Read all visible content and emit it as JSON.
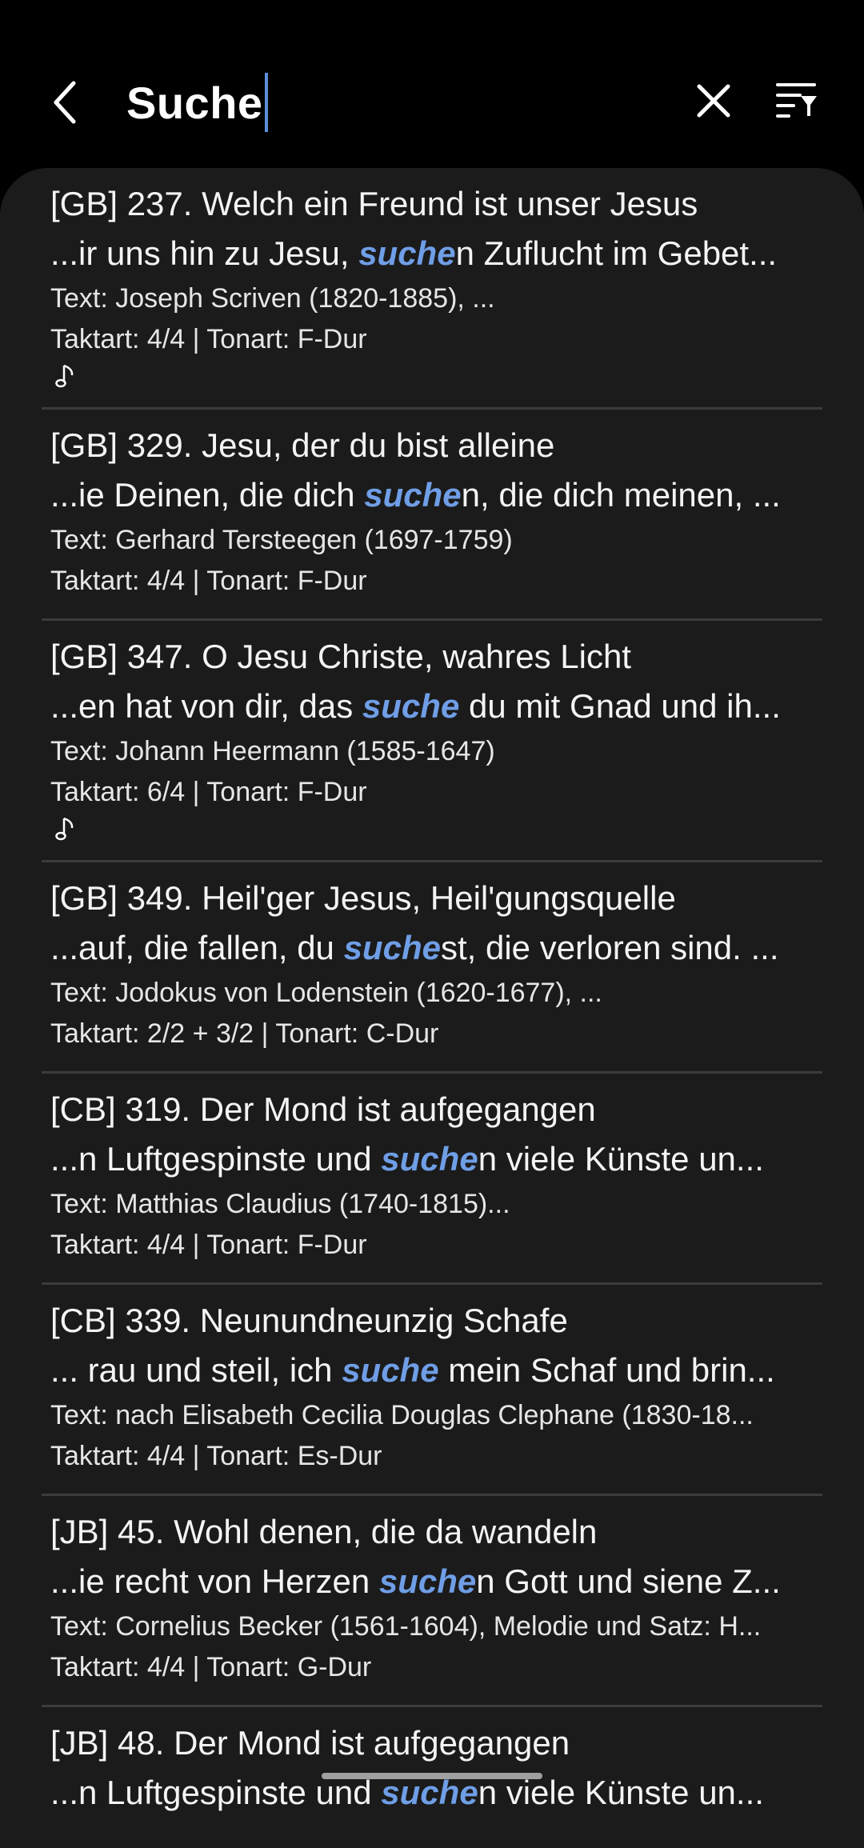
{
  "header": {
    "search_value": "Suche",
    "back_icon": "chevron-left-icon",
    "clear_icon": "close-icon",
    "filter_icon": "filter-list-icon"
  },
  "colors": {
    "highlight": "#6f9ee6",
    "background": "#000000",
    "panel": "#1b1b1b"
  },
  "results": [
    {
      "title": "[GB] 237. Welch ein Freund ist unser Jesus",
      "snippet_pre": "...ir uns hin zu Jesu, ",
      "snippet_match": "suche",
      "snippet_post": "n Zuflucht im Gebet...",
      "author": "Text: Joseph Scriven (1820-1885), ...",
      "meta": "Taktart: 4/4  |  Tonart: F-Dur",
      "has_audio": true
    },
    {
      "title": "[GB] 329. Jesu, der du bist alleine",
      "snippet_pre": "...ie Deinen, die dich ",
      "snippet_match": "suche",
      "snippet_post": "n, die dich meinen, ...",
      "author": "Text: Gerhard Tersteegen (1697-1759)",
      "meta": "Taktart: 4/4  |  Tonart: F-Dur",
      "has_audio": false
    },
    {
      "title": "[GB] 347. O Jesu Christe, wahres Licht",
      "snippet_pre": "...en hat von dir, das ",
      "snippet_match": "suche",
      "snippet_post": " du mit Gnad und ih...",
      "author": "Text: Johann Heermann (1585-1647)",
      "meta": "Taktart: 6/4  |  Tonart: F-Dur",
      "has_audio": true
    },
    {
      "title": "[GB] 349. Heil'ger Jesus, Heil'gungsquelle",
      "snippet_pre": "...auf, die fallen, du ",
      "snippet_match": "suche",
      "snippet_post": "st, die verloren sind. ...",
      "author": "Text: Jodokus von Lodenstein (1620-1677), ...",
      "meta": "Taktart: 2/2 + 3/2  |  Tonart: C-Dur",
      "has_audio": false
    },
    {
      "title": "[CB] 319. Der Mond ist aufgegangen",
      "snippet_pre": "...n Luftgespinste und ",
      "snippet_match": "suche",
      "snippet_post": "n viele Künste un...",
      "author": "Text: Matthias Claudius (1740-1815)...",
      "meta": "Taktart: 4/4  |  Tonart: F-Dur",
      "has_audio": false
    },
    {
      "title": "[CB] 339. Neunundneunzig Schafe",
      "snippet_pre": "... rau und steil, ich ",
      "snippet_match": "suche",
      "snippet_post": " mein Schaf und brin...",
      "author": "Text: nach Elisabeth Cecilia Douglas Clephane (1830-18...",
      "meta": "Taktart: 4/4  |  Tonart: Es-Dur",
      "has_audio": false
    },
    {
      "title": "[JB] 45. Wohl denen, die da wandeln",
      "snippet_pre": "...ie recht von Herzen ",
      "snippet_match": "suche",
      "snippet_post": "n Gott und siene Z...",
      "author": "Text: Cornelius Becker (1561-1604), Melodie und Satz: H...",
      "meta": "Taktart: 4/4  |  Tonart: G-Dur",
      "has_audio": false
    },
    {
      "title": "[JB] 48. Der Mond ist aufgegangen",
      "snippet_pre": "...n Luftgespinste und ",
      "snippet_match": "suche",
      "snippet_post": "n viele Künste un...",
      "author": "",
      "meta": "",
      "has_audio": false
    }
  ]
}
